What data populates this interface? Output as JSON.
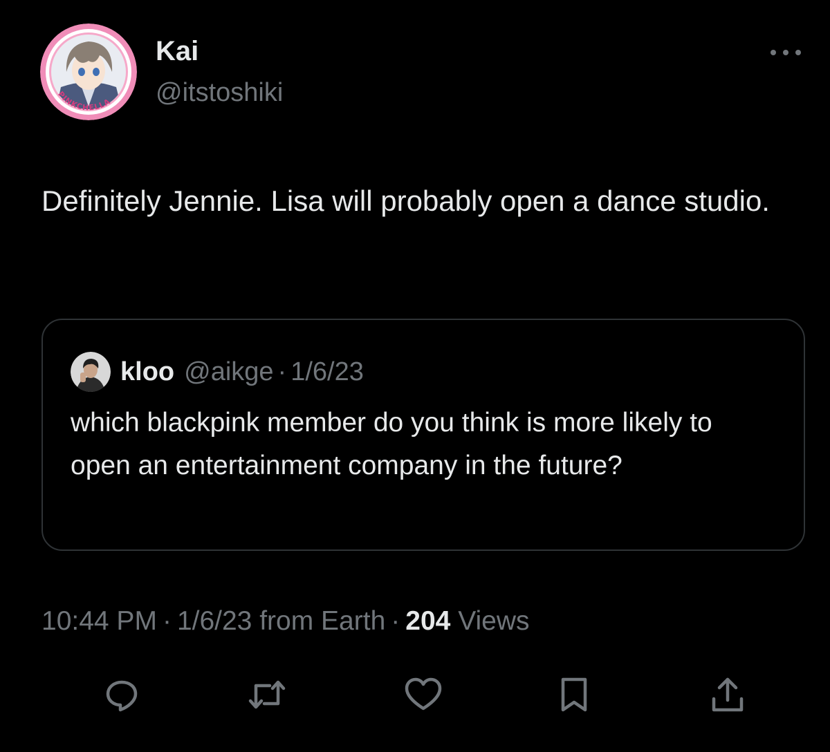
{
  "author": {
    "display_name": "Kai",
    "handle": "@itstoshiki",
    "avatar_badge_text": "PINKCHELLA"
  },
  "tweet": {
    "text": "Definitely Jennie. Lisa will probably open a dance studio."
  },
  "quote": {
    "display_name": "kloo",
    "handle": "@aikge",
    "separator": "·",
    "date": "1/6/23",
    "text": "which blackpink member do you think is more likely to open an entertainment company in the future?"
  },
  "meta": {
    "time": "10:44 PM",
    "separator": "·",
    "date_source": "1/6/23 from Earth",
    "views_count": "204",
    "views_label": "Views"
  },
  "actions": {
    "icons": [
      "reply-icon",
      "retweet-icon",
      "like-icon",
      "bookmark-icon",
      "share-icon"
    ]
  },
  "colors": {
    "background": "#000000",
    "text_primary": "#e7e9ea",
    "text_secondary": "#71767b",
    "border": "#2f3336",
    "avatar_ring": "#f08db8"
  }
}
